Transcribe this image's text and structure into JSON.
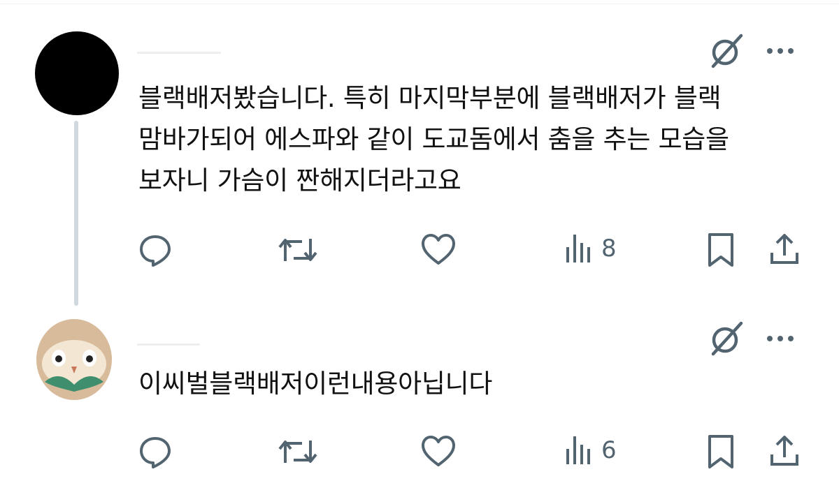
{
  "posts": [
    {
      "id": "post-1",
      "avatar": "black-circle-avatar",
      "text": "블랙배저봤습니다. 특히 마지막부분에 블랙배저가 블랙\n맘바가되어 에스파와 같이 도교돔에서 춤을 추는 모습을\n보자니 가슴이 짠해지더라고요",
      "views": "8",
      "has_thread_line": true
    },
    {
      "id": "post-2",
      "avatar": "owl-avatar",
      "text": "이씨벌블랙배저이런내용아닙니다",
      "views": "6",
      "has_thread_line": false
    }
  ],
  "icons": {
    "grok": "grok-icon",
    "more": "more-icon",
    "reply": "reply-icon",
    "repost": "repost-icon",
    "like": "like-icon",
    "views": "views-icon",
    "bookmark": "bookmark-icon",
    "share": "share-icon"
  },
  "colors": {
    "icon_gray": "#536471",
    "text": "#0f1419",
    "thread_line": "#cfd9de",
    "owl_face": "#f3e6d3",
    "owl_head": "#d7bb9a",
    "owl_leaf": "#3f8f6e"
  }
}
